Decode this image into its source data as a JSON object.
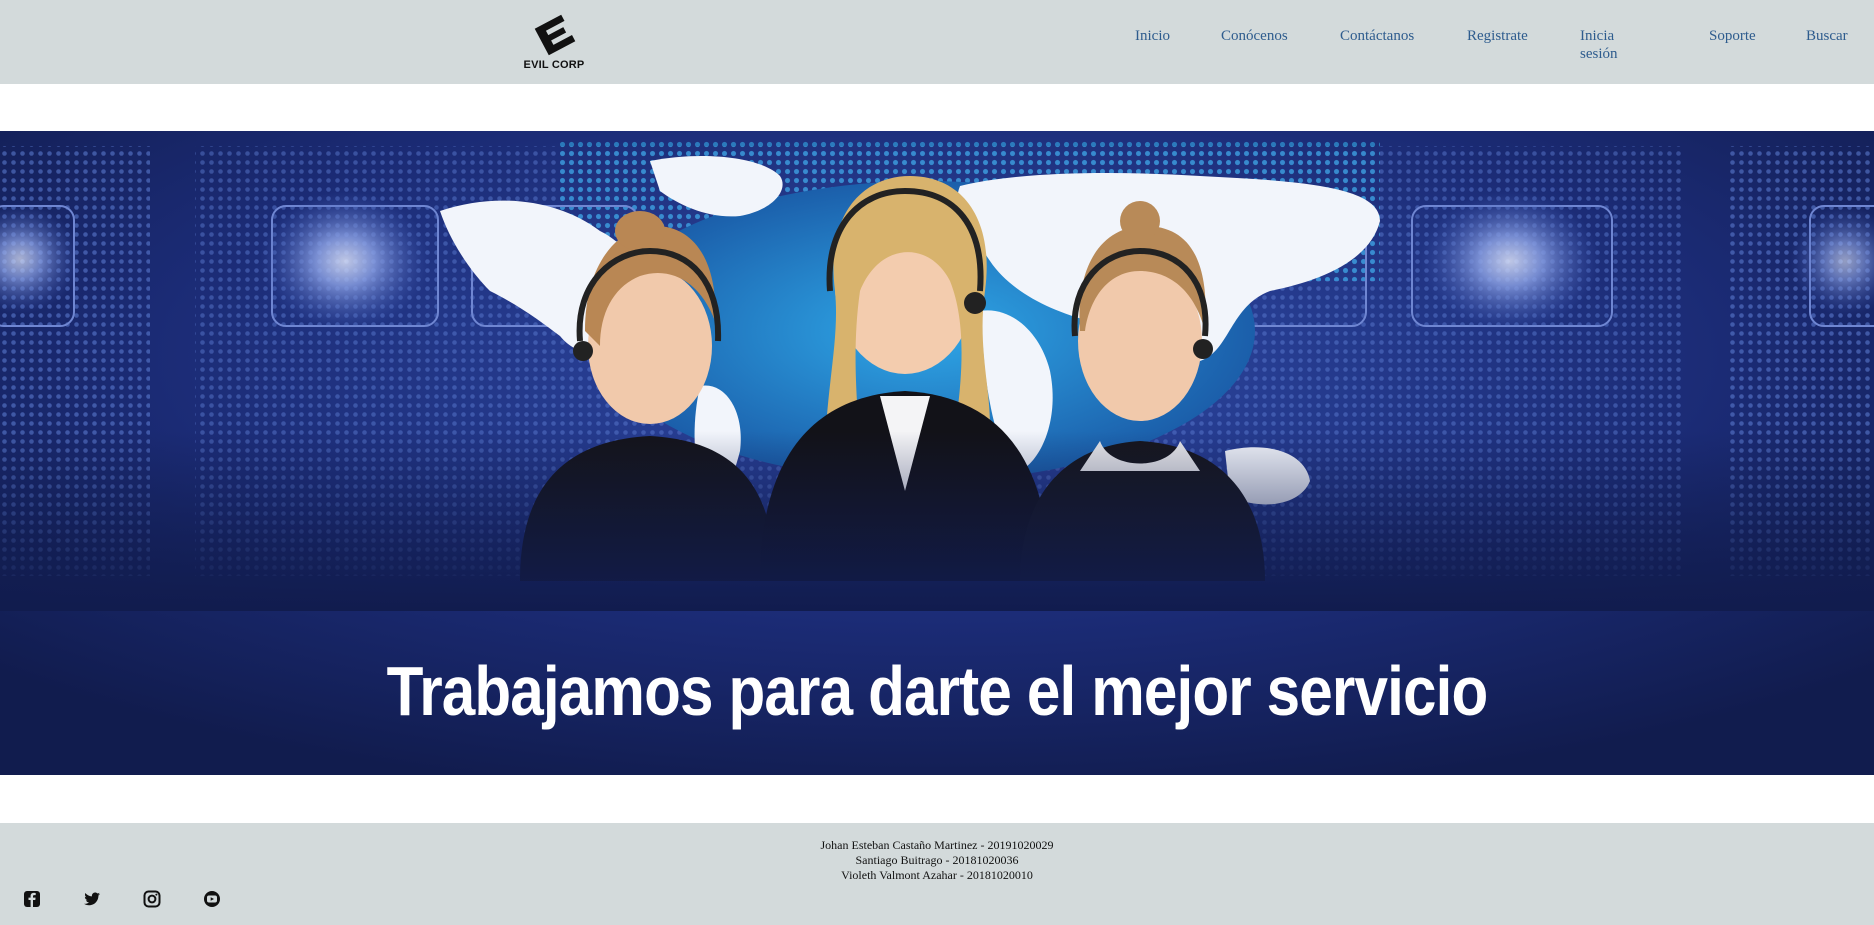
{
  "brand": {
    "name": "EVIL CORP",
    "icon": "evil-corp-logo"
  },
  "nav": {
    "items": [
      {
        "label": "Inicio"
      },
      {
        "label": "Conócenos"
      },
      {
        "label": "Contáctanos"
      },
      {
        "label": "Registrate"
      },
      {
        "label": "Inicia sesión"
      },
      {
        "label": "Soporte"
      },
      {
        "label": "Buscar"
      }
    ]
  },
  "hero": {
    "image": "call-center-agents-world-map",
    "title": "Trabajamos para darte el mejor servicio"
  },
  "footer": {
    "credits": [
      "Johan Esteban Castaño Martinez - 20191020029",
      "Santiago Buitrago - 20181020036",
      "Violeth Valmont Azahar - 20181020010"
    ],
    "social": [
      "facebook-icon",
      "twitter-icon",
      "instagram-icon",
      "youtube-icon"
    ]
  },
  "colors": {
    "header_bg": "#d3dadb",
    "nav_link": "#2e5c8e",
    "hero_bg": "#111c4e",
    "hero_text": "#ffffff"
  }
}
